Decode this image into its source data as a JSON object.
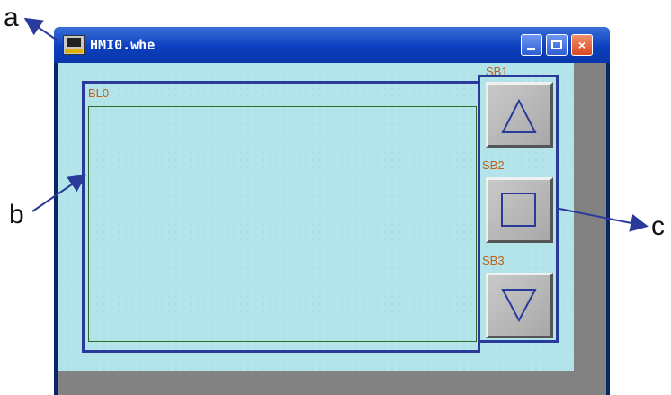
{
  "callouts": {
    "a": "a",
    "b": "b",
    "c": "c"
  },
  "window": {
    "title": "HMI0.whe",
    "controls": {
      "minimize": "minimize-icon",
      "maximize": "maximize-icon",
      "close": "×"
    }
  },
  "canvas": {
    "block_label": "BL0",
    "buttons": [
      {
        "label": "SB1",
        "icon": "triangle-up-icon"
      },
      {
        "label": "SB2",
        "icon": "square-icon"
      },
      {
        "label": "SB3",
        "icon": "triangle-down-icon"
      }
    ]
  },
  "colors": {
    "canvas_bg": "#b2e4ea",
    "annotation_blue": "#2a3a9a",
    "label_orange": "#c0601a",
    "titlebar_blue": "#0b3fbf"
  }
}
